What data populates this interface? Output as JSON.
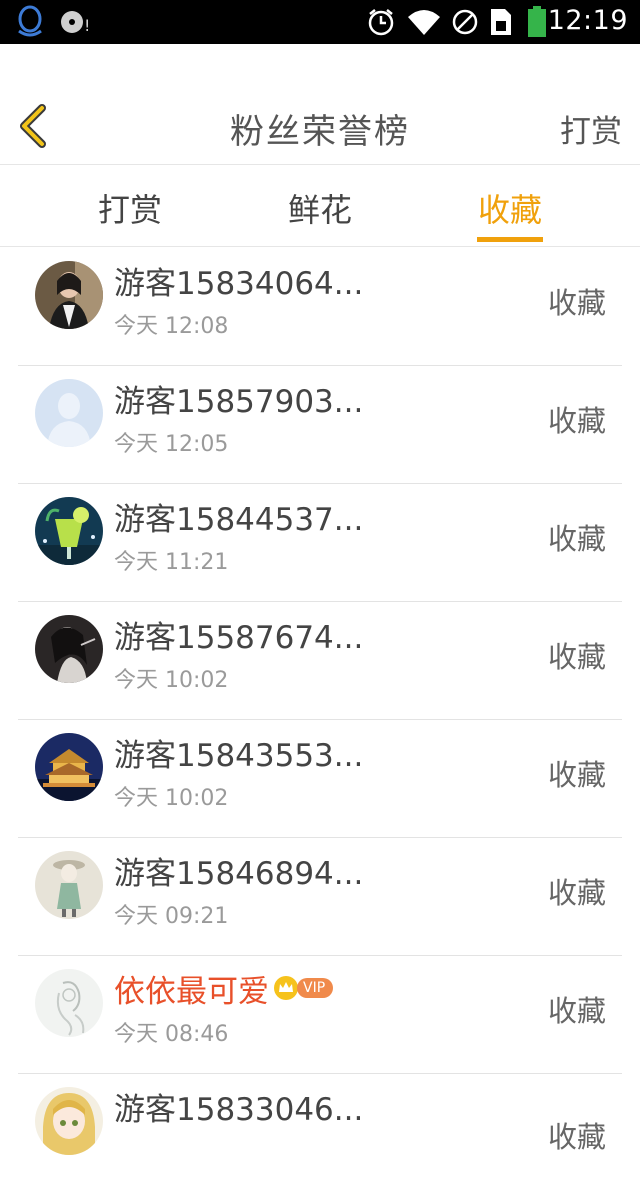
{
  "status_bar": {
    "time": "12:19",
    "icons": [
      "qq-icon",
      "media-icon",
      "alarm-icon",
      "wifi-icon",
      "no-sim-icon",
      "sim-icon",
      "battery-icon"
    ]
  },
  "header": {
    "title": "粉丝荣誉榜",
    "action_label": "打赏",
    "back_icon": "chevron-left-icon"
  },
  "tabs": [
    {
      "label": "打赏",
      "active": false
    },
    {
      "label": "鲜花",
      "active": false
    },
    {
      "label": "收藏",
      "active": true
    }
  ],
  "colors": {
    "accent": "#f0a10c",
    "vip_name": "#e8502a",
    "vip_badge": "#f08a4b",
    "text": "#444444",
    "secondary": "#9a9a9a"
  },
  "fans": [
    {
      "name": "游客15834064...",
      "time": "今天 12:08",
      "action": "收藏",
      "vip": false,
      "avatar": "photo-woman"
    },
    {
      "name": "游客15857903...",
      "time": "今天 12:05",
      "action": "收藏",
      "vip": false,
      "avatar": "default"
    },
    {
      "name": "游客15844537...",
      "time": "今天 11:21",
      "action": "收藏",
      "vip": false,
      "avatar": "drink"
    },
    {
      "name": "游客15587674...",
      "time": "今天 10:02",
      "action": "收藏",
      "vip": false,
      "avatar": "anime-dark"
    },
    {
      "name": "游客15843553...",
      "time": "今天 10:02",
      "action": "收藏",
      "vip": false,
      "avatar": "building"
    },
    {
      "name": "游客15846894...",
      "time": "今天 09:21",
      "action": "收藏",
      "vip": false,
      "avatar": "sketch-girl"
    },
    {
      "name": "依依最可爱",
      "time": "今天 08:46",
      "action": "收藏",
      "vip": true,
      "vip_label": "VIP",
      "avatar": "sketch-light"
    },
    {
      "name": "游客15833046...",
      "time": "",
      "action": "收藏",
      "vip": false,
      "avatar": "anime-blonde"
    }
  ]
}
